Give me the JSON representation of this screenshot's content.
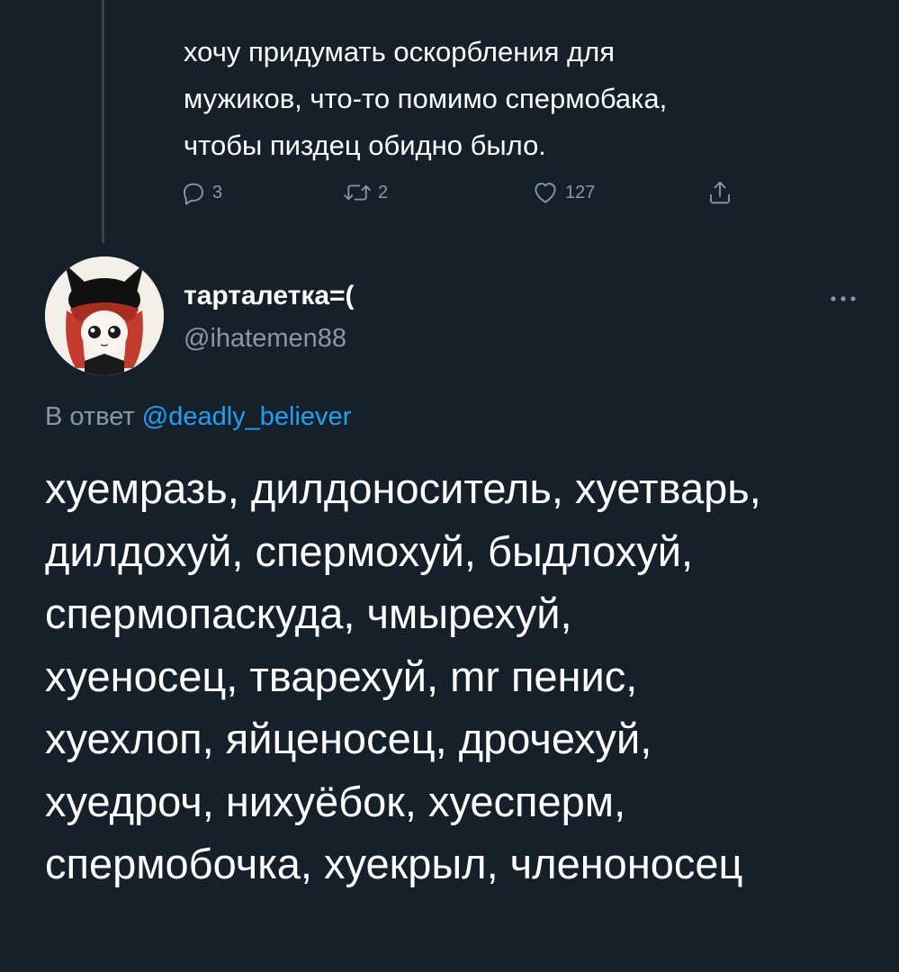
{
  "parent_tweet": {
    "text_lines": [
      "хочу придумать оскорбления для",
      "мужиков, что-то помимо спермобака,",
      "чтобы пиздец обидно было."
    ],
    "replies": "3",
    "retweets": "2",
    "likes": "127"
  },
  "reply_tweet": {
    "author_name": "тарталетка=(",
    "author_handle": "@ihatemen88",
    "reply_prefix": "В ответ ",
    "reply_mention": "@deadly_believer",
    "text_lines": [
      "хуемразь, дилдоноситель, хуетварь,",
      "дилдохуй, спермохуй, быдлохуй,",
      "спермопаскуда, чмырехуй,",
      "хуеносец, тварехуй, mr пенис,",
      "хуехлоп, яйценосец, дрочехуй,",
      "хуедроч, нихуёбок, хуесперм,",
      "спермобочка, хуекрыл, членоносец"
    ]
  },
  "icons": {
    "reply": "reply-icon",
    "retweet": "retweet-icon",
    "like": "heart-icon",
    "share": "share-icon",
    "more": "more-icon"
  },
  "colors": {
    "background": "#15202b",
    "text": "#ffffff",
    "muted": "#8899a6",
    "link": "#1da1f2",
    "thread_line": "#38444d"
  }
}
